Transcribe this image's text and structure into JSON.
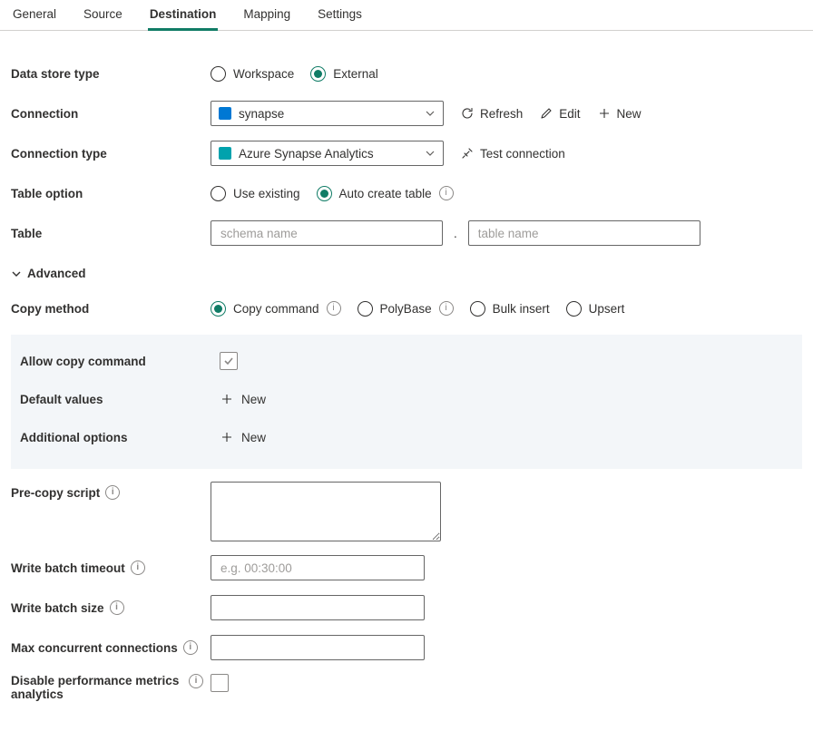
{
  "tabs": {
    "general": "General",
    "source": "Source",
    "destination": "Destination",
    "mapping": "Mapping",
    "settings": "Settings"
  },
  "labels": {
    "dataStoreType": "Data store type",
    "connection": "Connection",
    "connectionType": "Connection type",
    "tableOption": "Table option",
    "table": "Table",
    "advanced": "Advanced",
    "copyMethod": "Copy method",
    "allowCopyCommand": "Allow copy command",
    "defaultValues": "Default values",
    "additionalOptions": "Additional options",
    "preCopyScript": "Pre-copy script",
    "writeBatchTimeout": "Write batch timeout",
    "writeBatchSize": "Write batch size",
    "maxConcurrent": "Max concurrent connections",
    "disableMetrics": "Disable performance metrics analytics"
  },
  "dataStoreType": {
    "workspace": "Workspace",
    "external": "External",
    "selected": "external"
  },
  "connection": {
    "value": "synapse",
    "refresh": "Refresh",
    "edit": "Edit",
    "newAction": "New"
  },
  "connectionType": {
    "value": "Azure Synapse Analytics",
    "test": "Test connection"
  },
  "tableOption": {
    "useExisting": "Use existing",
    "autoCreate": "Auto create table",
    "selected": "autoCreate"
  },
  "table": {
    "schemaPlaceholder": "schema name",
    "schemaValue": "",
    "tablePlaceholder": "table name",
    "tableValue": ""
  },
  "copyMethod": {
    "copyCommand": "Copy command",
    "polyBase": "PolyBase",
    "bulkInsert": "Bulk insert",
    "upsert": "Upsert",
    "selected": "copyCommand"
  },
  "allowCopyCommandChecked": true,
  "newLabel": "New",
  "preCopyScriptValue": "",
  "writeBatchTimeout": {
    "placeholder": "e.g. 00:30:00",
    "value": ""
  },
  "writeBatchSizeValue": "",
  "maxConcurrentValue": "",
  "disableMetricsChecked": false
}
